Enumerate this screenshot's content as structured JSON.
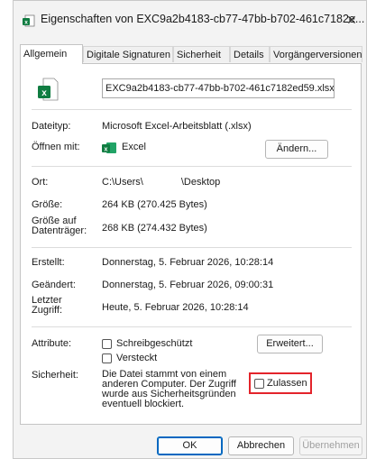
{
  "window": {
    "title": "Eigenschaften von EXC9a2b4183-cb77-47bb-b702-461c7182e...",
    "close": "✕"
  },
  "tabs": [
    {
      "label": "Allgemein",
      "active": true
    },
    {
      "label": "Digitale Signaturen",
      "active": false
    },
    {
      "label": "Sicherheit",
      "active": false
    },
    {
      "label": "Details",
      "active": false
    },
    {
      "label": "Vorgängerversionen",
      "active": false
    }
  ],
  "general": {
    "filename": "EXC9a2b4183-cb77-47bb-b702-461c7182ed59.xlsx",
    "filetype_label": "Dateityp:",
    "filetype_value": "Microsoft Excel-Arbeitsblatt (.xlsx)",
    "openwith_label": "Öffnen mit:",
    "openwith_value": "Excel",
    "change_button": "Ändern...",
    "location_label": "Ort:",
    "location_prefix": "C:\\Users\\",
    "location_suffix": "\\Desktop",
    "size_label": "Größe:",
    "size_value": "264 KB (270.425 Bytes)",
    "disksize_label_1": "Größe auf",
    "disksize_label_2": "Datenträger:",
    "disksize_value": "268 KB (274.432 Bytes)",
    "created_label": "Erstellt:",
    "created_value": "Donnerstag, 5. Februar 2026, 10:28:14",
    "modified_label": "Geändert:",
    "modified_value": "Donnerstag, 5. Februar 2026, 09:00:31",
    "accessed_label_1": "Letzter",
    "accessed_label_2": "Zugriff:",
    "accessed_value": "Heute, 5. Februar 2026, 10:28:14",
    "attributes_label": "Attribute:",
    "readonly_label": "Schreibgeschützt",
    "hidden_label": "Versteckt",
    "advanced_button": "Erweitert...",
    "security_label": "Sicherheit:",
    "security_text_1": "Die Datei stammt von einem",
    "security_text_2": "anderen Computer. Der Zugriff",
    "security_text_3": "wurde aus Sicherheitsgründen",
    "security_text_4": "eventuell blockiert.",
    "unblock_label": "Zulassen"
  },
  "footer": {
    "ok": "OK",
    "cancel": "Abbrechen",
    "apply": "Übernehmen"
  },
  "colors": {
    "excel_green": "#107c41",
    "highlight": "#e3242b",
    "accent": "#0067c0"
  }
}
